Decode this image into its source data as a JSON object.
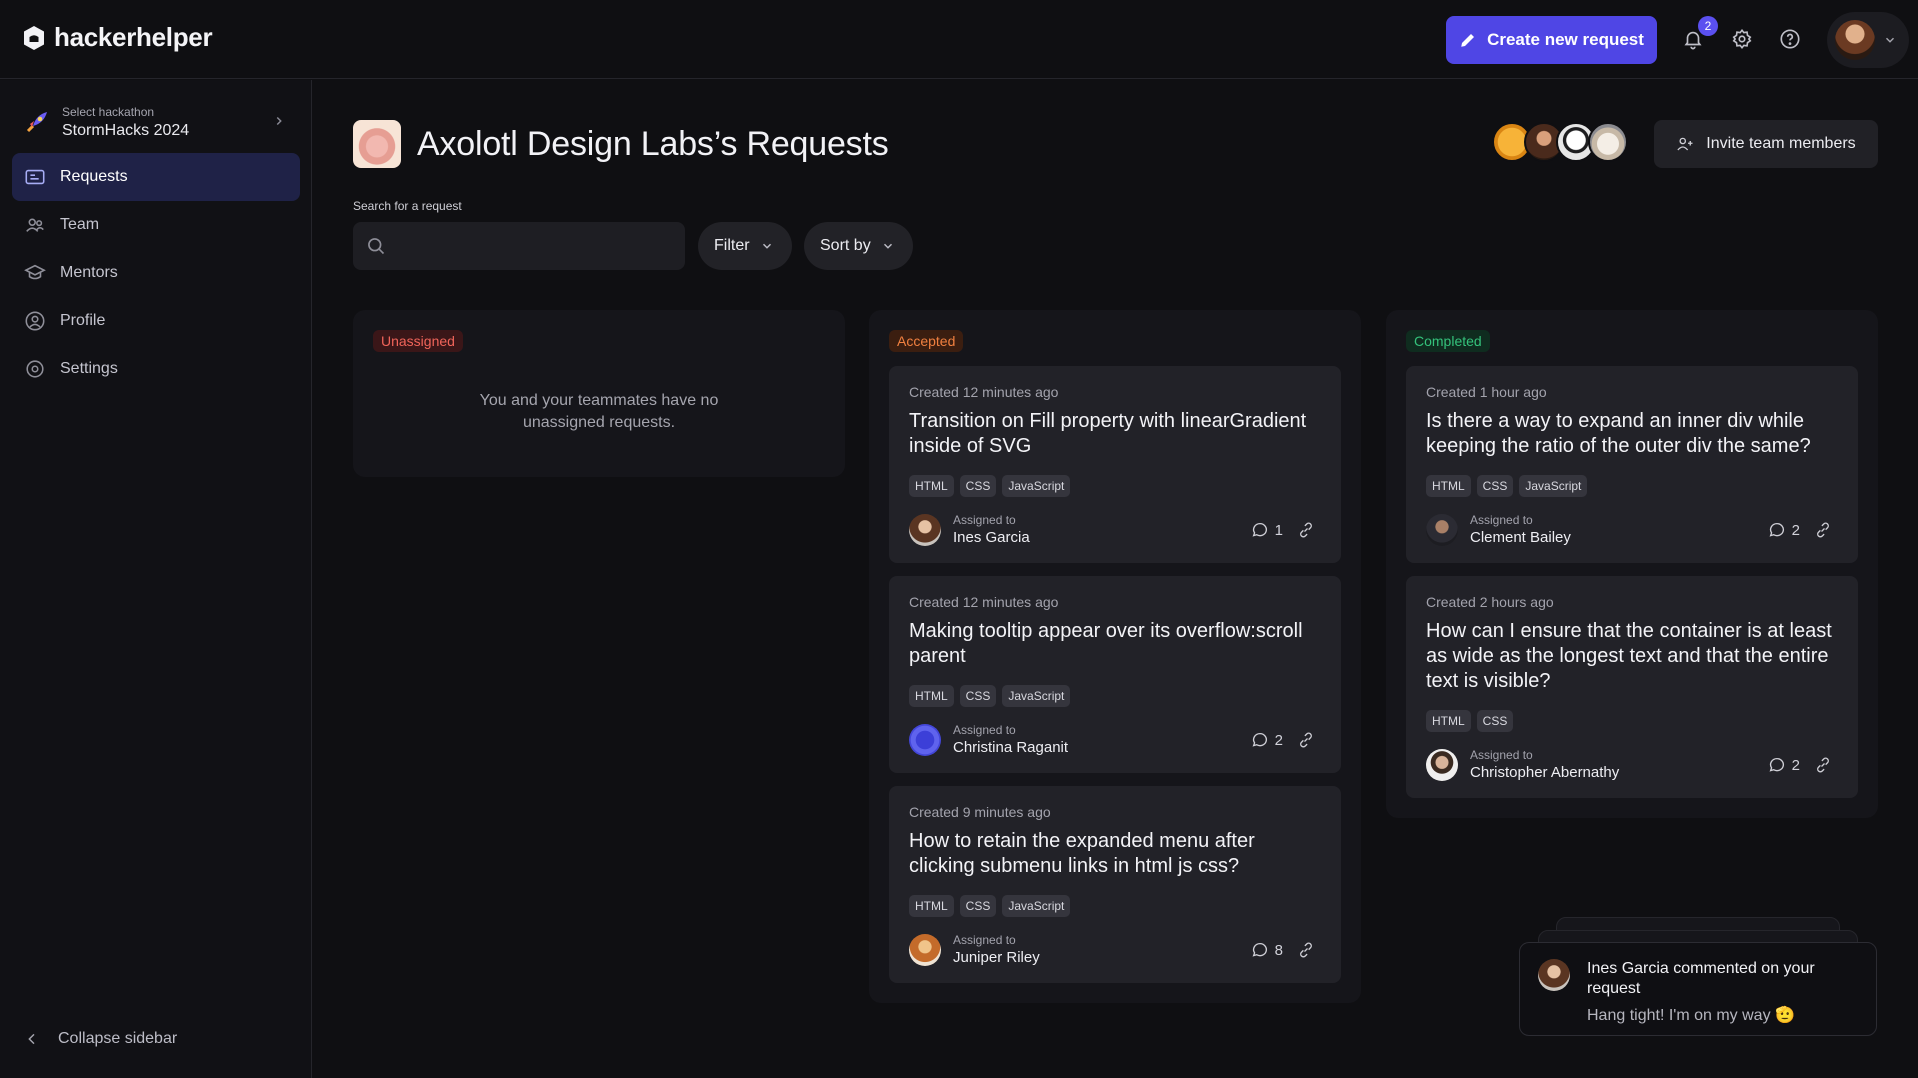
{
  "app": {
    "name": "hackerhelper"
  },
  "header": {
    "create_label": "Create new request",
    "notification_count": "2"
  },
  "sidebar": {
    "hackathon_label": "Select hackathon",
    "hackathon_name": "StormHacks 2024",
    "items": [
      {
        "label": "Requests",
        "icon": "ticket-icon",
        "active": true
      },
      {
        "label": "Team",
        "icon": "team-icon"
      },
      {
        "label": "Mentors",
        "icon": "mortarboard-icon"
      },
      {
        "label": "Profile",
        "icon": "user-circle-icon"
      },
      {
        "label": "Settings",
        "icon": "gear-icon"
      }
    ],
    "collapse_label": "Collapse sidebar"
  },
  "main": {
    "title": "Axolotl Design Labs’s Requests",
    "invite_label": "Invite team members",
    "search_label": "Search for a request",
    "search_placeholder": "",
    "filter_label": "Filter",
    "sort_label": "Sort by"
  },
  "columns": [
    {
      "status": "Unassigned",
      "empty_text": "You and your teammates have no unassigned requests."
    },
    {
      "status": "Accepted",
      "cards": [
        {
          "created": "Created 12 minutes ago",
          "title": "Transition on Fill property with linearGradient inside of SVG",
          "tags": [
            "HTML",
            "CSS",
            "JavaScript"
          ],
          "assigned_label": "Assigned to",
          "assignee": "Ines Garcia",
          "comments": "1"
        },
        {
          "created": "Created 12 minutes ago",
          "title": "Making tooltip appear over its overflow:scroll parent",
          "tags": [
            "HTML",
            "CSS",
            "JavaScript"
          ],
          "assigned_label": "Assigned to",
          "assignee": "Christina Raganit",
          "comments": "2"
        },
        {
          "created": "Created 9 minutes ago",
          "title": "How to retain the expanded menu after clicking submenu links in html js css?",
          "tags": [
            "HTML",
            "CSS",
            "JavaScript"
          ],
          "assigned_label": "Assigned to",
          "assignee": "Juniper Riley",
          "comments": "8"
        }
      ]
    },
    {
      "status": "Completed",
      "cards": [
        {
          "created": "Created 1 hour ago",
          "title": "Is there a way to expand an inner div while keeping the ratio of the outer div the same?",
          "tags": [
            "HTML",
            "CSS",
            "JavaScript"
          ],
          "assigned_label": "Assigned to",
          "assignee": "Clement Bailey",
          "comments": "2"
        },
        {
          "created": "Created 2 hours ago",
          "title": "How can I ensure that the container is at least as wide as the longest text and that the entire text is visible?",
          "tags": [
            "HTML",
            "CSS"
          ],
          "assigned_label": "Assigned to",
          "assignee": "Christopher Abernathy",
          "comments": "2"
        }
      ]
    }
  ],
  "toast": {
    "title": "Ines Garcia commented on your request",
    "message": "Hang tight! I'm on my way 🫡"
  },
  "colors": {
    "accent": "#4f46e5",
    "unassigned": "#f0645a",
    "accepted": "#f08040",
    "completed": "#34c27b"
  }
}
